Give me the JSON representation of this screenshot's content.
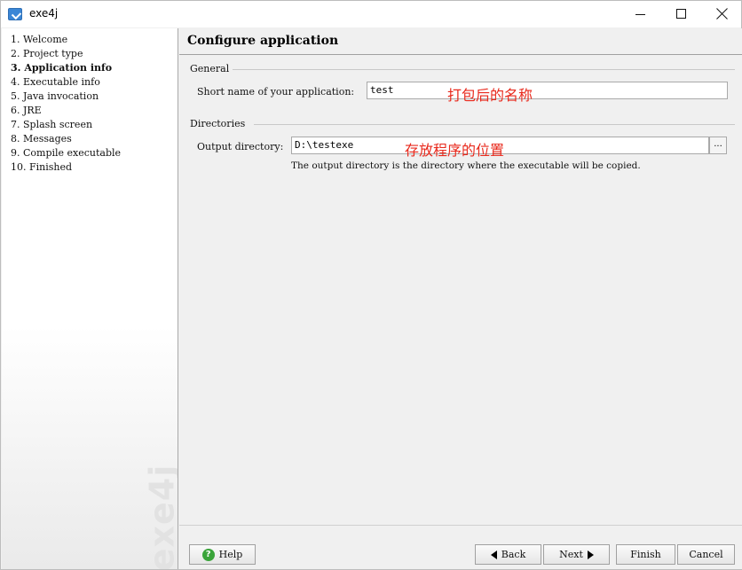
{
  "window": {
    "title": "exe4j",
    "minimize_label": "minimize",
    "maximize_label": "maximize",
    "close_label": "close"
  },
  "steps": [
    {
      "label": "1.  Welcome",
      "active": false
    },
    {
      "label": "2.  Project type",
      "active": false
    },
    {
      "label": "3.  Application info",
      "active": true
    },
    {
      "label": "4.  Executable info",
      "active": false
    },
    {
      "label": "5.  Java invocation",
      "active": false
    },
    {
      "label": "6.  JRE",
      "active": false
    },
    {
      "label": "7.  Splash screen",
      "active": false
    },
    {
      "label": "8.  Messages",
      "active": false
    },
    {
      "label": "9.  Compile executable",
      "active": false
    },
    {
      "label": "10.  Finished",
      "active": false
    }
  ],
  "watermark": "exe4j",
  "page": {
    "title": "Configure application",
    "general_group": "General",
    "short_name_label": "Short name of your application:",
    "short_name_value": "test",
    "short_name_annotation": "打包后的名称",
    "directories_group": "Directories",
    "output_dir_label": "Output directory:",
    "output_dir_value": "D:\\testexe",
    "output_dir_annotation": "存放程序的位置",
    "browse_label": "...",
    "output_dir_hint": "The output directory is the directory where the executable will be copied."
  },
  "buttons": {
    "help": "Help",
    "back": "Back",
    "next": "Next",
    "finish": "Finish",
    "cancel": "Cancel"
  },
  "icons": {
    "app": "exe4j-app-icon",
    "help": "help-icon",
    "back": "arrow-left-icon",
    "next": "arrow-right-icon"
  },
  "colors": {
    "annotation": "#e8291c",
    "help_icon": "#3aa43a"
  }
}
